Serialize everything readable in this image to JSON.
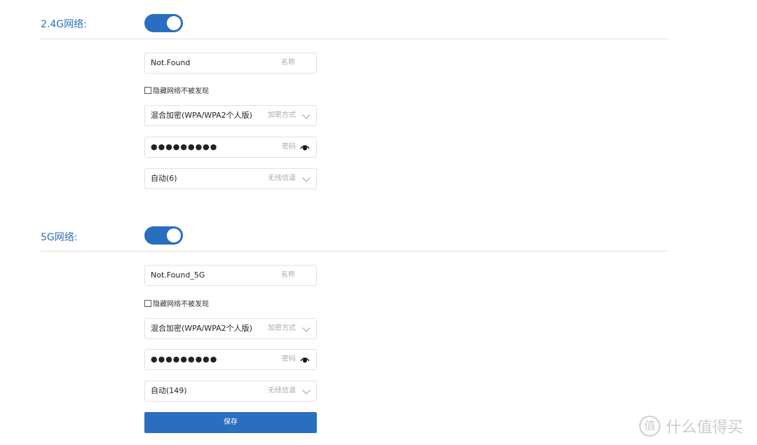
{
  "sections": [
    {
      "label": "2.4G网络:",
      "enabled": true,
      "ssid": {
        "value": "Not.Found",
        "hint": "名称"
      },
      "hidden_network": {
        "label": "隐藏网络不被发现",
        "checked": false
      },
      "encryption": {
        "value": "混合加密(WPA/WPA2个人版)",
        "hint": "加密方式"
      },
      "password": {
        "value": "●●●●●●●●●",
        "hint": "密码"
      },
      "channel": {
        "value": "自动(6)",
        "hint": "无线信道"
      }
    },
    {
      "label": "5G网络:",
      "enabled": true,
      "ssid": {
        "value": "Not.Found_5G",
        "hint": "名称"
      },
      "hidden_network": {
        "label": "隐藏网络不被发现",
        "checked": false
      },
      "encryption": {
        "value": "混合加密(WPA/WPA2个人版)",
        "hint": "加密方式"
      },
      "password": {
        "value": "●●●●●●●●●",
        "hint": "密码"
      },
      "channel": {
        "value": "自动(149)",
        "hint": "无线信道"
      }
    }
  ],
  "save_label": "保存",
  "watermark": {
    "logo": "值",
    "text": "什么值得买"
  },
  "colors": {
    "accent": "#2a6fbf"
  }
}
